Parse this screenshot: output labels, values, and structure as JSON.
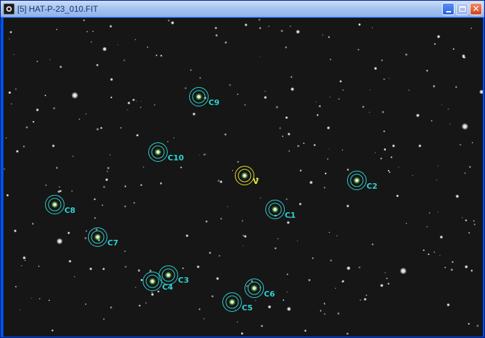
{
  "window": {
    "title": "[5] HAT-P-23_010.FIT",
    "buttons": {
      "minimize": "minimize",
      "maximize": "maximize",
      "close": "close"
    }
  },
  "colors": {
    "comparison": "#2ed3d3",
    "variable": "#e6e62e",
    "titlebar": "#a9c6f0"
  },
  "apertures": [
    {
      "label": "V",
      "kind": "variable"
    },
    {
      "label": "C1",
      "kind": "comparison"
    },
    {
      "label": "C2",
      "kind": "comparison"
    },
    {
      "label": "C3",
      "kind": "comparison"
    },
    {
      "label": "C4",
      "kind": "comparison"
    },
    {
      "label": "C5",
      "kind": "comparison"
    },
    {
      "label": "C6",
      "kind": "comparison"
    },
    {
      "label": "C7",
      "kind": "comparison"
    },
    {
      "label": "C8",
      "kind": "comparison"
    },
    {
      "label": "C9",
      "kind": "comparison"
    },
    {
      "label": "C10",
      "kind": "comparison"
    }
  ]
}
